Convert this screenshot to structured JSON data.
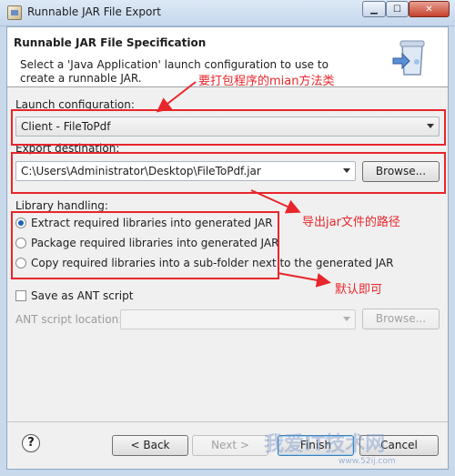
{
  "window": {
    "title": "Runnable JAR File Export",
    "minimize_icon": "minimize-icon",
    "maximize_icon": "maximize-icon",
    "close_icon": "close-icon"
  },
  "header": {
    "title": "Runnable JAR File Specification",
    "description": "Select a 'Java Application' launch configuration to use to create a runnable JAR."
  },
  "launch": {
    "label": "Launch configuration:",
    "value": "Client - FileToPdf"
  },
  "export": {
    "label": "Export destination:",
    "value": "C:\\Users\\Administrator\\Desktop\\FileToPdf.jar",
    "browse_label": "Browse..."
  },
  "library": {
    "label": "Library handling:",
    "options": [
      {
        "label": "Extract required libraries into generated JAR",
        "checked": true
      },
      {
        "label": "Package required libraries into generated JAR",
        "checked": false
      },
      {
        "label": "Copy required libraries into a sub-folder next to the generated JAR",
        "checked": false
      }
    ]
  },
  "ant": {
    "checkbox_label": "Save as ANT script",
    "location_label": "ANT script location:",
    "location_value": "",
    "browse_label": "Browse..."
  },
  "footer": {
    "help_label": "?",
    "back_label": "< Back",
    "next_label": "Next >",
    "finish_label": "Finish",
    "cancel_label": "Cancel"
  },
  "annotations": {
    "main_method": "要打包程序的mian方法类",
    "jar_path": "导出jar文件的路径",
    "default": "默认即可",
    "color": "#e8262b"
  },
  "watermark": {
    "text": "我爱IT技术网",
    "url": "www.52ij.com"
  }
}
